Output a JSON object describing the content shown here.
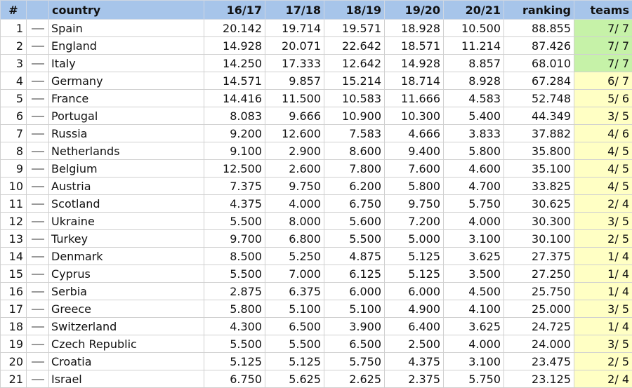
{
  "colors": {
    "header_bg": "#a7c5ea",
    "teams_full": "#c6f2a8",
    "teams_partial": "#ffffc4",
    "trend_dash": "#9a9a9a"
  },
  "header": {
    "rank": "#",
    "country": "country",
    "s1617": "16/17",
    "s1718": "17/18",
    "s1819": "18/19",
    "s1920": "19/20",
    "s2021": "20/21",
    "ranking": "ranking",
    "teams": "teams"
  },
  "trend_icon": "dash-icon",
  "rows": [
    {
      "rank": "1",
      "country": "Spain",
      "s1617": "20.142",
      "s1718": "19.714",
      "s1819": "19.571",
      "s1920": "18.928",
      "s2021": "10.500",
      "ranking": "88.855",
      "teams": "7/ 7",
      "status": "full"
    },
    {
      "rank": "2",
      "country": "England",
      "s1617": "14.928",
      "s1718": "20.071",
      "s1819": "22.642",
      "s1920": "18.571",
      "s2021": "11.214",
      "ranking": "87.426",
      "teams": "7/ 7",
      "status": "full"
    },
    {
      "rank": "3",
      "country": "Italy",
      "s1617": "14.250",
      "s1718": "17.333",
      "s1819": "12.642",
      "s1920": "14.928",
      "s2021": "8.857",
      "ranking": "68.010",
      "teams": "7/ 7",
      "status": "full"
    },
    {
      "rank": "4",
      "country": "Germany",
      "s1617": "14.571",
      "s1718": "9.857",
      "s1819": "15.214",
      "s1920": "18.714",
      "s2021": "8.928",
      "ranking": "67.284",
      "teams": "6/ 7",
      "status": "partial"
    },
    {
      "rank": "5",
      "country": "France",
      "s1617": "14.416",
      "s1718": "11.500",
      "s1819": "10.583",
      "s1920": "11.666",
      "s2021": "4.583",
      "ranking": "52.748",
      "teams": "5/ 6",
      "status": "partial"
    },
    {
      "rank": "6",
      "country": "Portugal",
      "s1617": "8.083",
      "s1718": "9.666",
      "s1819": "10.900",
      "s1920": "10.300",
      "s2021": "5.400",
      "ranking": "44.349",
      "teams": "3/ 5",
      "status": "partial"
    },
    {
      "rank": "7",
      "country": "Russia",
      "s1617": "9.200",
      "s1718": "12.600",
      "s1819": "7.583",
      "s1920": "4.666",
      "s2021": "3.833",
      "ranking": "37.882",
      "teams": "4/ 6",
      "status": "partial"
    },
    {
      "rank": "8",
      "country": "Netherlands",
      "s1617": "9.100",
      "s1718": "2.900",
      "s1819": "8.600",
      "s1920": "9.400",
      "s2021": "5.800",
      "ranking": "35.800",
      "teams": "4/ 5",
      "status": "partial"
    },
    {
      "rank": "9",
      "country": "Belgium",
      "s1617": "12.500",
      "s1718": "2.600",
      "s1819": "7.800",
      "s1920": "7.600",
      "s2021": "4.600",
      "ranking": "35.100",
      "teams": "4/ 5",
      "status": "partial"
    },
    {
      "rank": "10",
      "country": "Austria",
      "s1617": "7.375",
      "s1718": "9.750",
      "s1819": "6.200",
      "s1920": "5.800",
      "s2021": "4.700",
      "ranking": "33.825",
      "teams": "4/ 5",
      "status": "partial"
    },
    {
      "rank": "11",
      "country": "Scotland",
      "s1617": "4.375",
      "s1718": "4.000",
      "s1819": "6.750",
      "s1920": "9.750",
      "s2021": "5.750",
      "ranking": "30.625",
      "teams": "2/ 4",
      "status": "partial"
    },
    {
      "rank": "12",
      "country": "Ukraine",
      "s1617": "5.500",
      "s1718": "8.000",
      "s1819": "5.600",
      "s1920": "7.200",
      "s2021": "4.000",
      "ranking": "30.300",
      "teams": "3/ 5",
      "status": "partial"
    },
    {
      "rank": "13",
      "country": "Turkey",
      "s1617": "9.700",
      "s1718": "6.800",
      "s1819": "5.500",
      "s1920": "5.000",
      "s2021": "3.100",
      "ranking": "30.100",
      "teams": "2/ 5",
      "status": "partial"
    },
    {
      "rank": "14",
      "country": "Denmark",
      "s1617": "8.500",
      "s1718": "5.250",
      "s1819": "4.875",
      "s1920": "5.125",
      "s2021": "3.625",
      "ranking": "27.375",
      "teams": "1/ 4",
      "status": "partial"
    },
    {
      "rank": "15",
      "country": "Cyprus",
      "s1617": "5.500",
      "s1718": "7.000",
      "s1819": "6.125",
      "s1920": "5.125",
      "s2021": "3.500",
      "ranking": "27.250",
      "teams": "1/ 4",
      "status": "partial"
    },
    {
      "rank": "16",
      "country": "Serbia",
      "s1617": "2.875",
      "s1718": "6.375",
      "s1819": "6.000",
      "s1920": "6.000",
      "s2021": "4.500",
      "ranking": "25.750",
      "teams": "1/ 4",
      "status": "partial"
    },
    {
      "rank": "17",
      "country": "Greece",
      "s1617": "5.800",
      "s1718": "5.100",
      "s1819": "5.100",
      "s1920": "4.900",
      "s2021": "4.100",
      "ranking": "25.000",
      "teams": "3/ 5",
      "status": "partial"
    },
    {
      "rank": "18",
      "country": "Switzerland",
      "s1617": "4.300",
      "s1718": "6.500",
      "s1819": "3.900",
      "s1920": "6.400",
      "s2021": "3.625",
      "ranking": "24.725",
      "teams": "1/ 4",
      "status": "partial"
    },
    {
      "rank": "19",
      "country": "Czech Republic",
      "s1617": "5.500",
      "s1718": "5.500",
      "s1819": "6.500",
      "s1920": "2.500",
      "s2021": "4.000",
      "ranking": "24.000",
      "teams": "3/ 5",
      "status": "partial"
    },
    {
      "rank": "20",
      "country": "Croatia",
      "s1617": "5.125",
      "s1718": "5.125",
      "s1819": "5.750",
      "s1920": "4.375",
      "s2021": "3.100",
      "ranking": "23.475",
      "teams": "2/ 5",
      "status": "partial"
    },
    {
      "rank": "21",
      "country": "Israel",
      "s1617": "6.750",
      "s1718": "5.625",
      "s1819": "2.625",
      "s1920": "2.375",
      "s2021": "5.750",
      "ranking": "23.125",
      "teams": "2/ 4",
      "status": "partial"
    }
  ]
}
